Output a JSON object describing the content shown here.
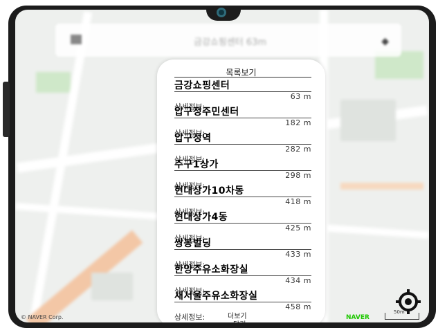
{
  "search": {
    "text": "금강쇼핑센터 63m"
  },
  "panel": {
    "title": "목록보기",
    "items": [
      {
        "name": "금강쇼핑센터",
        "distance": "63 m",
        "detail": "상세정보:"
      },
      {
        "name": "압구정주민센터",
        "distance": "182 m",
        "detail": "상세정보:"
      },
      {
        "name": "압구정역",
        "distance": "282 m",
        "detail": "상세정보:"
      },
      {
        "name": "주구1상가",
        "distance": "298 m",
        "detail": "상세정보:"
      },
      {
        "name": "현대상가10차동",
        "distance": "418 m",
        "detail": "상세정보:"
      },
      {
        "name": "현대상가4동",
        "distance": "425 m",
        "detail": "상세정보:"
      },
      {
        "name": "쌍봉빌딩",
        "distance": "433 m",
        "detail": "상세정보:"
      },
      {
        "name": "한양주유소화장실",
        "distance": "434 m",
        "detail": "상세정보:"
      },
      {
        "name": "새서울주유소화장실",
        "distance": "458 m",
        "detail": "상세정보:"
      }
    ],
    "more_label": "더보기",
    "close_label": "닫기"
  },
  "map": {
    "copyright": "© NAVER Corp.",
    "brand": "NAVER",
    "scale_label": "50m"
  },
  "colors": {
    "naver_green": "#1ec800",
    "panel_bg": "#ffffff"
  }
}
